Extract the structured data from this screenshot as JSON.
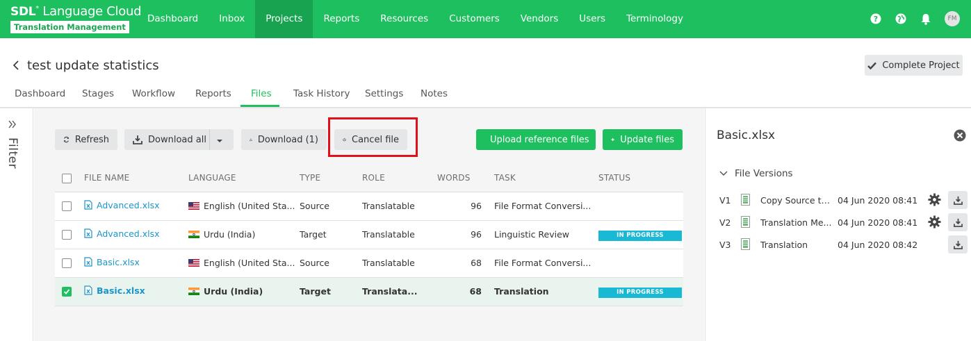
{
  "app": {
    "logo_brand": "SDL",
    "logo_product": "Language Cloud",
    "logo_sub": "Translation Management"
  },
  "nav": {
    "items": [
      {
        "label": "Dashboard"
      },
      {
        "label": "Inbox"
      },
      {
        "label": "Projects"
      },
      {
        "label": "Reports"
      },
      {
        "label": "Resources"
      },
      {
        "label": "Customers"
      },
      {
        "label": "Vendors"
      },
      {
        "label": "Users"
      },
      {
        "label": "Terminology"
      }
    ],
    "active": "Projects",
    "user_initials": "FM"
  },
  "header": {
    "project_title": "test update statistics",
    "complete_label": "Complete Project"
  },
  "subtabs": {
    "items": [
      {
        "label": "Dashboard"
      },
      {
        "label": "Stages"
      },
      {
        "label": "Workflow"
      },
      {
        "label": "Reports"
      },
      {
        "label": "Files"
      },
      {
        "label": "Task History"
      },
      {
        "label": "Settings"
      },
      {
        "label": "Notes"
      }
    ],
    "active": "Files"
  },
  "filter": {
    "label": "Filter"
  },
  "toolbar": {
    "refresh": "Refresh",
    "download_all": "Download all",
    "download": "Download (1)",
    "cancel_file": "Cancel file",
    "upload_reference": "Upload reference files",
    "update_files": "Update files"
  },
  "table": {
    "headers": {
      "file_name": "FILE NAME",
      "language": "LANGUAGE",
      "type": "TYPE",
      "role": "ROLE",
      "words": "WORDS",
      "task": "TASK",
      "status": "STATUS"
    },
    "rows": [
      {
        "file": "Advanced.xlsx",
        "flag": "us",
        "language": "English (United Sta...",
        "type": "Source",
        "role": "Translatable",
        "words": "96",
        "task": "File Format Conversi...",
        "status": "",
        "checked": false
      },
      {
        "file": "Advanced.xlsx",
        "flag": "in",
        "language": "Urdu (India)",
        "type": "Target",
        "role": "Translatable",
        "words": "96",
        "task": "Linguistic Review",
        "status": "IN PROGRESS",
        "checked": false
      },
      {
        "file": "Basic.xlsx",
        "flag": "us",
        "language": "English (United Sta...",
        "type": "Source",
        "role": "Translatable",
        "words": "68",
        "task": "File Format Conversi...",
        "status": "",
        "checked": false
      },
      {
        "file": "Basic.xlsx",
        "flag": "in",
        "language": "Urdu (India)",
        "type": "Target",
        "role": "Translata...",
        "words": "68",
        "task": "Translation",
        "status": "IN PROGRESS",
        "checked": true
      }
    ]
  },
  "details": {
    "title": "Basic.xlsx",
    "section": "File Versions",
    "versions": [
      {
        "label": "V1",
        "name": "Copy Source to T...",
        "date": "04 Jun 2020 08:41",
        "has_gear": true
      },
      {
        "label": "V2",
        "name": "Translation Me...",
        "date": "04 Jun 2020 08:41",
        "has_gear": true
      },
      {
        "label": "V3",
        "name": "Translation",
        "date": "04 Jun 2020 08:42",
        "has_gear": false
      }
    ]
  },
  "colors": {
    "brand_green": "#1dbf5e",
    "status_cyan": "#19b8d4",
    "link_blue": "#1b94c8",
    "highlight_red": "#e0101a"
  }
}
